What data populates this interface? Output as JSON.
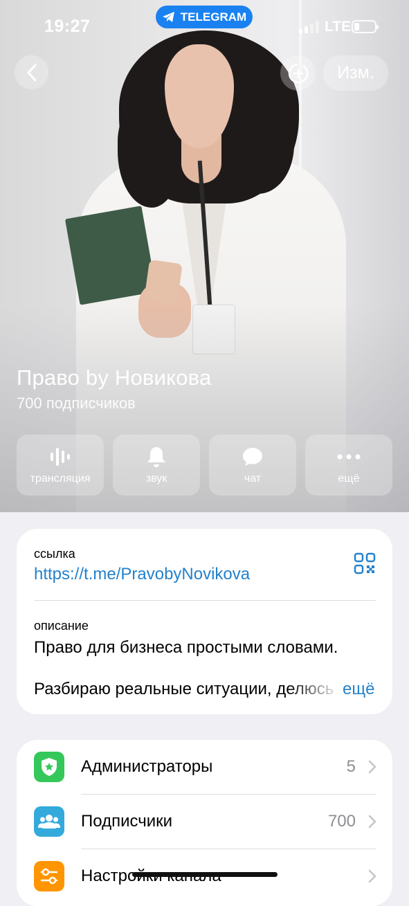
{
  "status_bar": {
    "time": "19:27",
    "app_badge": "TELEGRAM",
    "network": "LTE",
    "battery_level": 0.25
  },
  "nav": {
    "back_icon": "chevron-left-icon",
    "add_icon": "add-circle-icon",
    "edit_label": "Изм."
  },
  "profile": {
    "name": "Право by Новикова",
    "subscribers_text": "700 подписчиков"
  },
  "actions": [
    {
      "label": "трансляция",
      "icon": "live-stream-icon"
    },
    {
      "label": "звук",
      "icon": "bell-icon"
    },
    {
      "label": "чат",
      "icon": "chat-bubble-icon"
    },
    {
      "label": "ещё",
      "icon": "more-dots-icon"
    }
  ],
  "info": {
    "link_caption": "ссылка",
    "link_value": "https://t.me/PravobyNovikova",
    "description_caption": "описание",
    "description_line1": "Право для бизнеса простыми словами.",
    "description_line2": "Разбираю реальные ситуации, делюсь",
    "more_label": "ещё"
  },
  "settings_list": [
    {
      "label": "Администраторы",
      "value": "5",
      "icon": "shield-star-icon",
      "color": "#34c759"
    },
    {
      "label": "Подписчики",
      "value": "700",
      "icon": "people-icon",
      "color": "#34aadc"
    },
    {
      "label": "Настройки канала",
      "value": "",
      "icon": "sliders-icon",
      "color": "#ff9500"
    }
  ],
  "colors": {
    "accent": "#2481cc",
    "telegram_pill": "#1a82f0",
    "background": "#efeff4"
  }
}
